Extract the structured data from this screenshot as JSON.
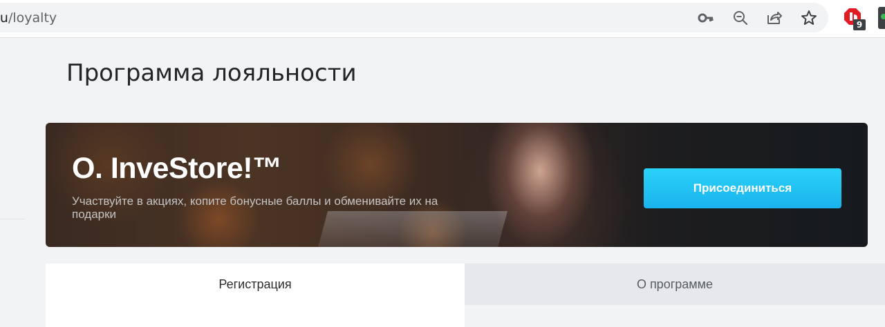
{
  "browser": {
    "url_host": "r.ru",
    "url_path": "/loyalty",
    "icons": [
      "key-icon",
      "zoom-out-icon",
      "share-icon",
      "star-icon"
    ],
    "extension_badge": "9"
  },
  "page": {
    "title": "Программа лояльности"
  },
  "banner": {
    "logo": "O. InveStore!™",
    "description": "Участвуйте в акциях, копите бонусные баллы и обменивайте их на подарки",
    "join_label": "Присоединиться",
    "button_color": "#1ec3f3"
  },
  "tabs": [
    {
      "label": "Регистрация",
      "active": true
    },
    {
      "label": "О программе",
      "active": false
    }
  ]
}
